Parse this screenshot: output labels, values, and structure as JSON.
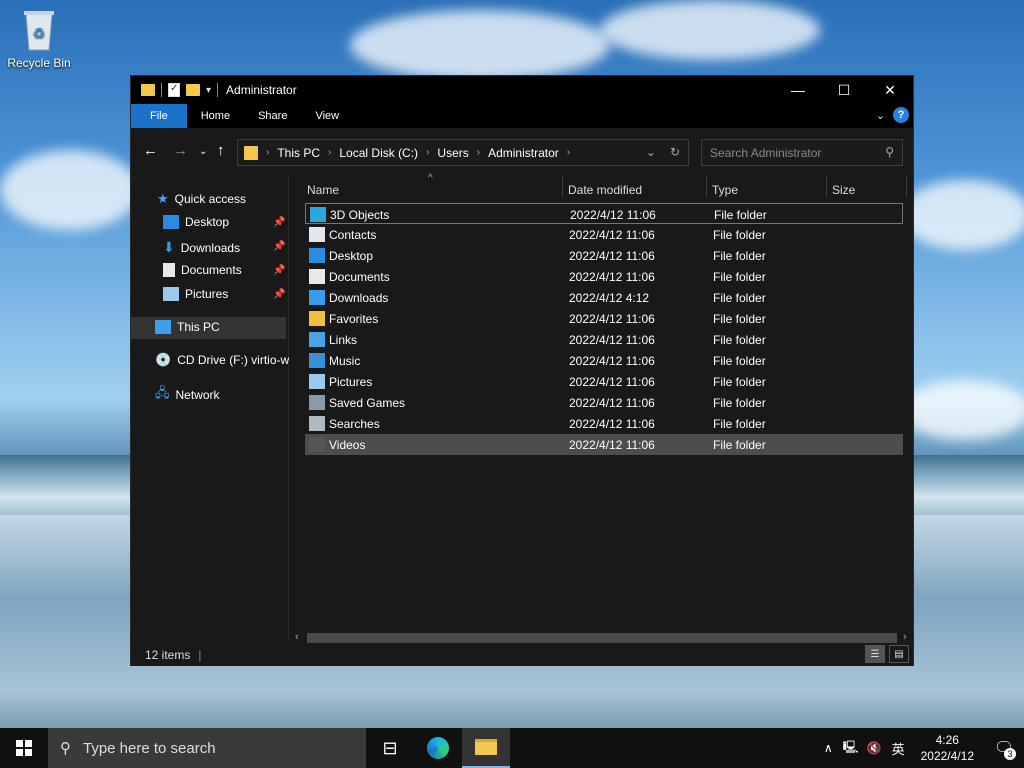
{
  "desktop": {
    "recycle_bin_label": "Recycle Bin"
  },
  "window": {
    "title": "Administrator",
    "ribbon_tabs": [
      "File",
      "Home",
      "Share",
      "View"
    ],
    "address": {
      "crumbs": [
        "This PC",
        "Local Disk (C:)",
        "Users",
        "Administrator"
      ]
    },
    "search_placeholder": "Search Administrator",
    "nav": {
      "quick_access": "Quick access",
      "quick_items": [
        "Desktop",
        "Downloads",
        "Documents",
        "Pictures"
      ],
      "this_pc": "This PC",
      "cd_drive": "CD Drive (F:) virtio-w",
      "network": "Network"
    },
    "columns": [
      "Name",
      "Date modified",
      "Type",
      "Size"
    ],
    "files": [
      {
        "name": "3D Objects",
        "date": "2022/4/12 11:06",
        "type": "File folder",
        "icon": "3d-objects-icon"
      },
      {
        "name": "Contacts",
        "date": "2022/4/12 11:06",
        "type": "File folder",
        "icon": "contacts-icon"
      },
      {
        "name": "Desktop",
        "date": "2022/4/12 11:06",
        "type": "File folder",
        "icon": "desktop-icon"
      },
      {
        "name": "Documents",
        "date": "2022/4/12 11:06",
        "type": "File folder",
        "icon": "documents-icon"
      },
      {
        "name": "Downloads",
        "date": "2022/4/12 4:12",
        "type": "File folder",
        "icon": "downloads-icon"
      },
      {
        "name": "Favorites",
        "date": "2022/4/12 11:06",
        "type": "File folder",
        "icon": "favorites-icon"
      },
      {
        "name": "Links",
        "date": "2022/4/12 11:06",
        "type": "File folder",
        "icon": "links-icon"
      },
      {
        "name": "Music",
        "date": "2022/4/12 11:06",
        "type": "File folder",
        "icon": "music-icon"
      },
      {
        "name": "Pictures",
        "date": "2022/4/12 11:06",
        "type": "File folder",
        "icon": "pictures-icon"
      },
      {
        "name": "Saved Games",
        "date": "2022/4/12 11:06",
        "type": "File folder",
        "icon": "saved-games-icon"
      },
      {
        "name": "Searches",
        "date": "2022/4/12 11:06",
        "type": "File folder",
        "icon": "searches-icon"
      },
      {
        "name": "Videos",
        "date": "2022/4/12 11:06",
        "type": "File folder",
        "icon": "videos-icon"
      }
    ],
    "status_text": "12 items"
  },
  "taskbar": {
    "search_placeholder": "Type here to search",
    "ime": "英",
    "time": "4:26",
    "date": "2022/4/12",
    "notification_count": "3"
  },
  "colors": {
    "accent": "#1a73c9",
    "window_bg": "#191919",
    "titlebar": "#000000"
  }
}
